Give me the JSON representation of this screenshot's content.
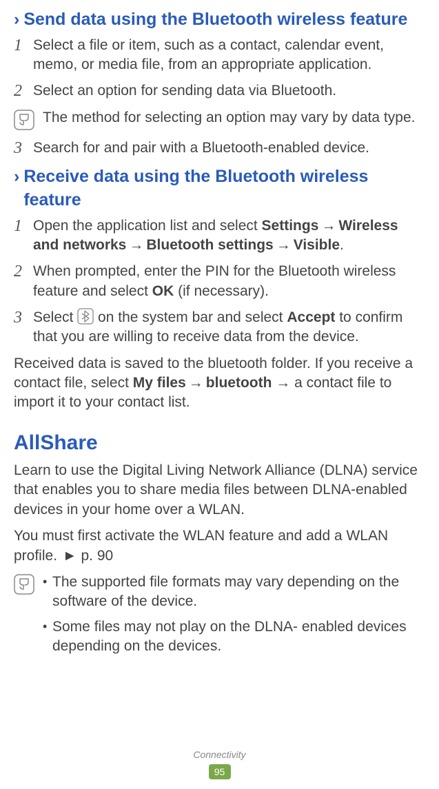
{
  "section1": {
    "title": "Send data using the Bluetooth wireless feature",
    "steps": [
      {
        "num": "1",
        "text": "Select a file or item, such as a contact, calendar event, memo, or media file, from an appropriate application."
      },
      {
        "num": "2",
        "text": "Select an option for sending data via Bluetooth."
      },
      {
        "num": "3",
        "text": "Search for and pair with a Bluetooth-enabled device."
      }
    ],
    "note": "The method for selecting an option may vary by data type."
  },
  "section2": {
    "title": "Receive data using the Bluetooth wireless feature",
    "steps": {
      "s1": {
        "num": "1",
        "pre": "Open the application list and select ",
        "b1": "Settings",
        "b2": "Wireless and networks",
        "b3": "Bluetooth settings",
        "b4": "Visible",
        "arrow": "→",
        "end": "."
      },
      "s2": {
        "num": "2",
        "pre": "When prompted, enter the PIN for the Bluetooth wireless feature and select ",
        "b1": "OK",
        "post": " (if necessary)."
      },
      "s3": {
        "num": "3",
        "pre": "Select ",
        "mid": " on the system bar and select ",
        "b1": "Accept",
        "post": " to confirm that you are willing to receive data from the device."
      }
    },
    "para": {
      "pre": "Received data is saved to the bluetooth folder. If you receive a contact file, select ",
      "b1": "My files",
      "arrow": "→",
      "b2": "bluetooth",
      "post": " → a contact file to import it to your contact list."
    }
  },
  "allshare": {
    "title": "AllShare",
    "p1": "Learn to use the Digital Living Network Alliance (DLNA) service that enables you to share media files between DLNA-enabled devices in your home over a WLAN.",
    "p2_pre": "You must first activate the WLAN feature and add a WLAN profile. ",
    "p2_ref": "► p. 90",
    "notes": [
      "The supported file formats may vary depending on the software of the device.",
      "Some files may not play on the DLNA- enabled devices depending on the devices."
    ]
  },
  "footer": {
    "label": "Connectivity",
    "page": "95"
  },
  "glyphs": {
    "chevron": "›",
    "bullet": "•"
  }
}
